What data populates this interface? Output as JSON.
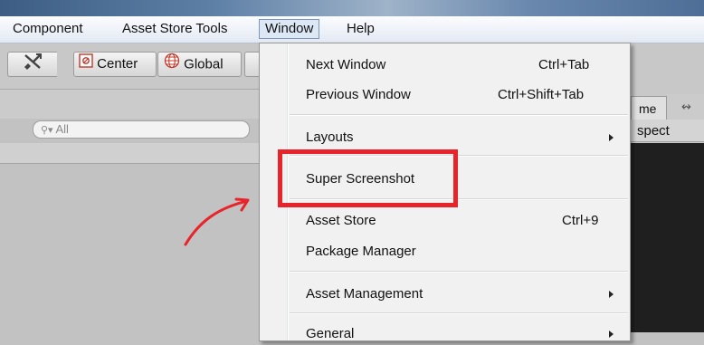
{
  "menubar": {
    "items": [
      "Component",
      "Asset Store Tools",
      "Window",
      "Help"
    ],
    "active_index": 2
  },
  "toolbar": {
    "center_label": "Center",
    "global_label": "Global"
  },
  "search": {
    "placeholder": "All"
  },
  "right_panel": {
    "tab_partial": "me",
    "aspect_partial": "spect"
  },
  "window_menu": {
    "items": [
      {
        "label": "Next Window",
        "shortcut": "Ctrl+Tab",
        "submenu": false
      },
      {
        "label": "Previous Window",
        "shortcut": "Ctrl+Shift+Tab",
        "submenu": false
      },
      {
        "label": "Layouts",
        "shortcut": "",
        "submenu": true
      },
      {
        "label": "Super Screenshot",
        "shortcut": "",
        "submenu": false
      },
      {
        "label": "Asset Store",
        "shortcut": "Ctrl+9",
        "submenu": false
      },
      {
        "label": "Package Manager",
        "shortcut": "",
        "submenu": false
      },
      {
        "label": "Asset Management",
        "shortcut": "",
        "submenu": true
      },
      {
        "label": "General",
        "shortcut": "",
        "submenu": true
      }
    ]
  },
  "annotation": {
    "highlighted_item": "Super Screenshot",
    "color": "#e8232a"
  }
}
